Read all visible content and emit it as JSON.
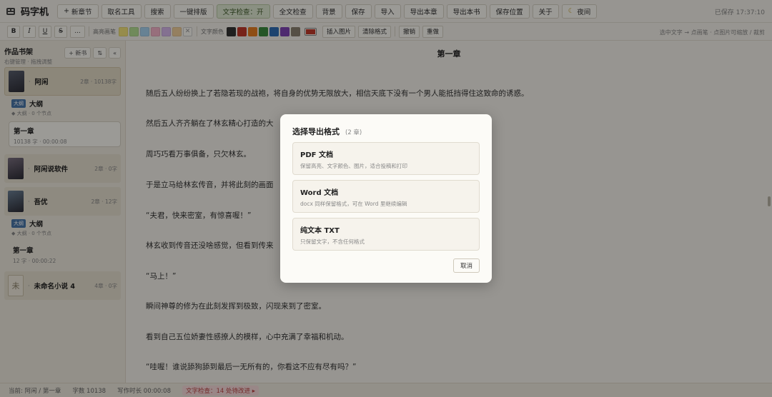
{
  "app": {
    "title": "码字机",
    "saved_status": "已保存 17:37:10"
  },
  "toolbar": {
    "new_chapter": "新章节",
    "naming_tool": "取名工具",
    "search": "搜索",
    "one_click_format": "一键排版",
    "text_check": "文字检查：开",
    "full_text_check": "全文检查",
    "background": "背景",
    "save": "保存",
    "import": "导入",
    "export_chapter": "导出本章",
    "export_book": "导出本书",
    "save_position": "保存位置",
    "about": "关于",
    "night_mode": "夜间"
  },
  "format_bar": {
    "bold": "B",
    "italic": "I",
    "underline": "U",
    "strike": "S",
    "more": "...",
    "highlight_label": "高亮画笔",
    "highlight_colors": [
      "#f2e27a",
      "#b5df94",
      "#a6d2ef",
      "#f4b3c8",
      "#d5b6ea",
      "#f1cf9b"
    ],
    "clear_mark": "✕",
    "text_color_label": "文字颜色",
    "text_colors": [
      "#333333",
      "#c0392b",
      "#e67e22",
      "#3a8a3e",
      "#2e6db4",
      "#7e44b3",
      "#8a8070"
    ],
    "current_text_color": "#c0392b",
    "insert_image": "插入图片",
    "clear_format": "清除格式",
    "undo": "撤销",
    "redo": "重做",
    "hint": "选中文字 → 点画笔 · 点图片可缩放 / 裁剪"
  },
  "sidebar": {
    "title": "作品书架",
    "subtitle": "右键管理 · 拖拽调整",
    "new_book": "新书",
    "sort_icon": "⇅",
    "collapse_icon": "«",
    "books": [
      {
        "name": "阿闲",
        "meta": "2章 · 10138字",
        "cover_color": "#5a5f6e"
      },
      {
        "name": "阿闲说软件",
        "meta": "2章 · 0字",
        "cover_color": "#7a6f7f"
      },
      {
        "name": "吾优",
        "meta": "2章 · 12字",
        "cover_color": "#6b7f94"
      },
      {
        "name": "未命名小说 4",
        "meta": "4章 · 0字",
        "cover_char": "未"
      }
    ],
    "outline_badge": "大纲",
    "outline_name": "大纲",
    "outline_meta": "◆ 大纲 · 0 个节点",
    "book1_chapter": {
      "name": "第一章",
      "meta": "10138 字 · 00:00:08"
    },
    "book3_outline_meta": "◆ 大纲 · 0 个节点",
    "book3_chapter": {
      "name": "第一章",
      "meta": "12 字 · 00:00:22"
    }
  },
  "editor": {
    "chapter_title": "第一章",
    "paragraphs": [
      "随后五人纷纷换上了若隐若现的战袍，将自身的优势无限放大，相信天底下没有一个男人能抵挡得住这致命的诱惑。",
      "然后五人齐齐躺在了林玄精心打造的大",
      "周巧巧看万事俱备，只欠林玄。",
      "于是立马给林玄传音，并将此刻的画面",
      "“夫君，快来密室，有惊喜喔！”",
      "林玄收到传音还没啥感觉，但看到传来",
      "“马上！”",
      "瞬间神尊的修为在此刻发挥到极致，闪现来到了密室。",
      "看到自己五位娇妻性感撩人的模样，心中充满了幸福和机动。",
      "“哇喔！谁说舔狗舔到最后一无所有的，你看这不应有尽有吗？”"
    ]
  },
  "status_bar": {
    "current": "当前: 阿闲 / 第一章",
    "word_count": "字数 10138",
    "writing_time": "写作时长 00:00:08",
    "check_badge": "文字检查：14 处待改进 ▸"
  },
  "export_modal": {
    "title": "选择导出格式",
    "count": "(2 章)",
    "options": [
      {
        "name": "PDF 文档",
        "desc": "保留高亮、文字颜色、图片，适合投稿和打印"
      },
      {
        "name": "Word 文档",
        "desc": "docx 同样保留格式，可在 Word 里继续编辑"
      },
      {
        "name": "纯文本 TXT",
        "desc": "只保留文字，不含任何格式"
      }
    ],
    "cancel": "取消"
  }
}
